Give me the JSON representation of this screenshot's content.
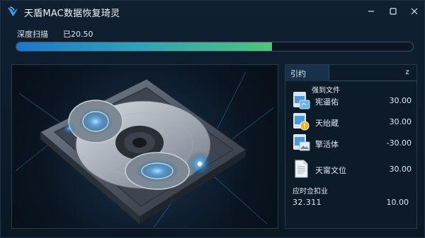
{
  "window": {
    "title": "天盾MAC数据恢复琦灵",
    "icons": {
      "logo": "bird-logo-icon",
      "minimize": "minimize-icon",
      "maximize": "maximize-icon",
      "close": "close-icon"
    }
  },
  "scan": {
    "label": "深度扫描",
    "elapsed": "已20.50",
    "progress": 0.645,
    "colors": {
      "start": "#1d77c9",
      "end": "#52c27a"
    }
  },
  "preview": {
    "icon": "hard-drive-illustration"
  },
  "results": {
    "tab_label": "引约",
    "sort_icon_glyph": "z",
    "group_label": "强到文件",
    "items": [
      {
        "name": "宪逼佑",
        "value": "30.00",
        "icon": "image-file-icon"
      },
      {
        "name": "天绐蔵",
        "value": "30.00",
        "icon": "warning-file-icon"
      },
      {
        "name": "擎活体",
        "value": "-30.00",
        "icon": "photo-file-icon"
      },
      {
        "name": "天甯文位",
        "value": "30.00",
        "icon": "document-file-icon"
      }
    ],
    "summary_label": "应时佥扣业",
    "summary_left": "32.311",
    "summary_right": "10.00"
  }
}
